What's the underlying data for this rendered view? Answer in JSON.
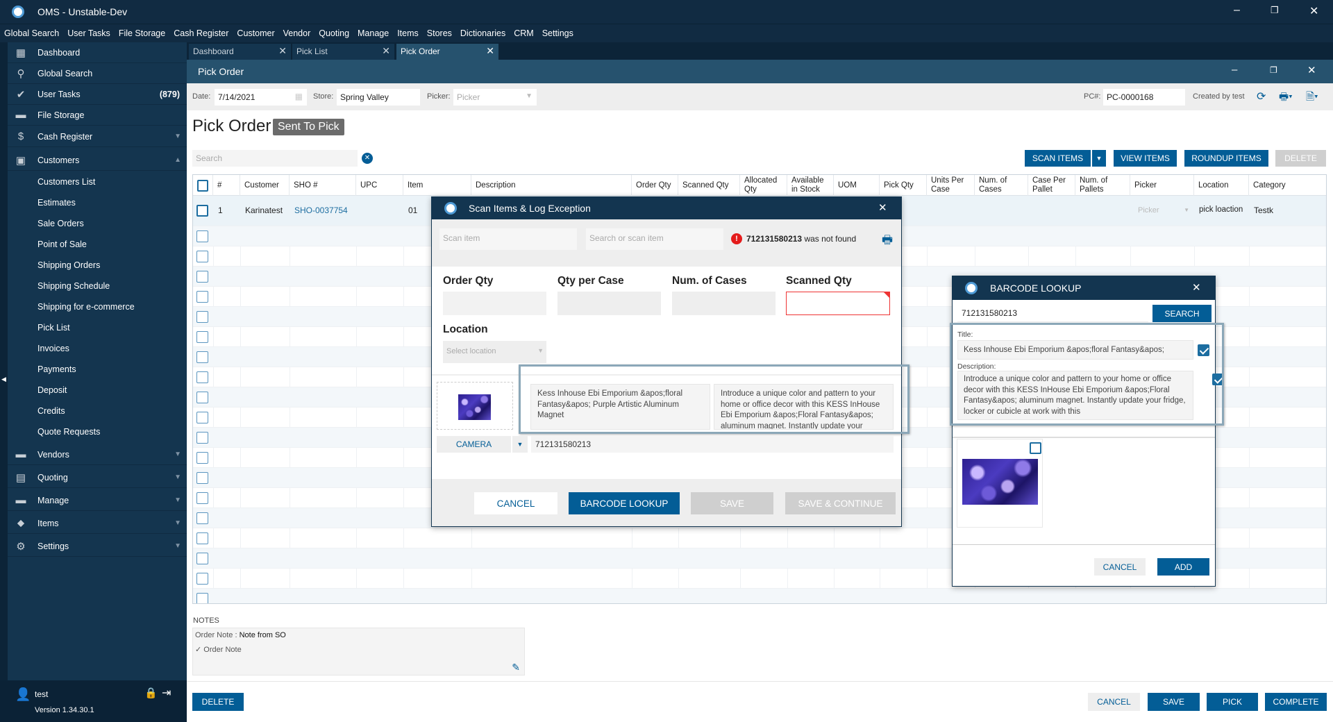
{
  "app": {
    "title": "OMS - Unstable-Dev"
  },
  "menu": [
    "Global Search",
    "User Tasks",
    "File Storage",
    "Cash Register",
    "Customer",
    "Vendor",
    "Quoting",
    "Manage",
    "Items",
    "Stores",
    "Dictionaries",
    "CRM",
    "Settings"
  ],
  "sidebar": {
    "items": [
      {
        "label": "Dashboard",
        "icon": "dashboard-icon"
      },
      {
        "label": "Global Search",
        "icon": "search-icon"
      },
      {
        "label": "User Tasks",
        "icon": "check-circle-icon",
        "badge": "(879)"
      },
      {
        "label": "File Storage",
        "icon": "folder-icon"
      },
      {
        "label": "Cash Register",
        "icon": "dollar-icon"
      },
      {
        "label": "Customers",
        "icon": "user-icon"
      }
    ],
    "customer_sub": [
      "Customers List",
      "Estimates",
      "Sale Orders",
      "Point of Sale",
      "Shipping Orders",
      "Shipping Schedule",
      "Shipping for e-commerce",
      "Pick List",
      "Invoices",
      "Payments",
      "Deposit",
      "Credits",
      "Quote Requests"
    ],
    "lower": [
      {
        "label": "Vendors",
        "icon": "truck-icon"
      },
      {
        "label": "Quoting",
        "icon": "calculator-icon"
      },
      {
        "label": "Manage",
        "icon": "briefcase-icon"
      },
      {
        "label": "Items",
        "icon": "tag-icon"
      },
      {
        "label": "Settings",
        "icon": "gear-icon"
      }
    ],
    "user": "test",
    "version": "Version 1.34.30.1"
  },
  "tabs": [
    {
      "label": "Dashboard"
    },
    {
      "label": "Pick List"
    },
    {
      "label": "Pick Order"
    }
  ],
  "window": {
    "title": "Pick Order"
  },
  "filters": {
    "date_label": "Date:",
    "date": "7/14/2021",
    "store_label": "Store:",
    "store": "Spring Valley",
    "picker_label": "Picker:",
    "picker_placeholder": "Picker",
    "pc_label": "PC#:",
    "pc": "PC-0000168",
    "created_by": "Created by test"
  },
  "page": {
    "heading": "Pick Order",
    "status": "Sent To Pick",
    "search_placeholder": "Search"
  },
  "actions": {
    "scan": "SCAN ITEMS",
    "view": "VIEW ITEMS",
    "roundup": "ROUNDUP ITEMS",
    "delete": "DELETE"
  },
  "table": {
    "columns": [
      "#",
      "Customer",
      "SHO #",
      "UPC",
      "Item",
      "Description",
      "Order Qty",
      "Scanned Qty",
      "Allocated Qty",
      "Available in Stock",
      "UOM",
      "Pick Qty",
      "Units Per Case",
      "Num. of Cases",
      "Case Per Pallet",
      "Num. of Pallets",
      "Picker",
      "Location",
      "Category"
    ],
    "rows": [
      {
        "num": "1",
        "customer": "Karinatest",
        "sho": "SHO-0037754",
        "upc": "",
        "item": "01",
        "picker": "Picker",
        "location": "pick loaction",
        "category": "Testk"
      }
    ]
  },
  "notes": {
    "label": "NOTES",
    "order_note_label": "Order Note",
    "order_note": "Note from SO",
    "check_label": "Order Note"
  },
  "footer": {
    "delete": "DELETE",
    "cancel": "CANCEL",
    "save": "SAVE",
    "pick": "PICK",
    "complete": "COMPLETE"
  },
  "scan_modal": {
    "title": "Scan Items & Log Exception",
    "scan_placeholder": "Scan item",
    "search_placeholder": "Search or scan item",
    "error_code": "712131580213",
    "error_text": "was not found",
    "order_qty": "Order Qty",
    "qty_per_case": "Qty per Case",
    "num_cases": "Num. of Cases",
    "scanned_qty": "Scanned Qty",
    "location": "Location",
    "location_placeholder": "Select location",
    "item_title": "Kess Inhouse Ebi Emporium &apos;floral Fantasy&apos; Purple Artistic Aluminum Magnet",
    "item_desc": "Introduce a unique color and pattern to your home or office decor with this KESS InHouse Ebi Emporium &apos;Floral Fantasy&apos; aluminum magnet. Instantly update your",
    "camera": "CAMERA",
    "barcode": "712131580213",
    "cancel": "CANCEL",
    "lookup": "BARCODE LOOKUP",
    "save": "SAVE",
    "save_continue": "SAVE & CONTINUE"
  },
  "barcode_modal": {
    "title": "BARCODE LOOKUP",
    "query": "712131580213",
    "search": "SEARCH",
    "title_label": "Title:",
    "title_value": "Kess Inhouse Ebi Emporium &apos;floral Fantasy&apos;",
    "desc_label": "Description:",
    "desc_value": "Introduce a unique color and pattern to your home or office decor with this KESS InHouse Ebi Emporium &apos;Floral Fantasy&apos; aluminum magnet. Instantly update your fridge, locker or cubicle at work with this",
    "cancel": "CANCEL",
    "add": "ADD",
    "title_checked": true,
    "desc_checked": true,
    "image_checked": false
  },
  "colors": {
    "primary": "#035d96",
    "header": "#112b42",
    "sidebar": "#14354f",
    "window": "#26526e"
  }
}
